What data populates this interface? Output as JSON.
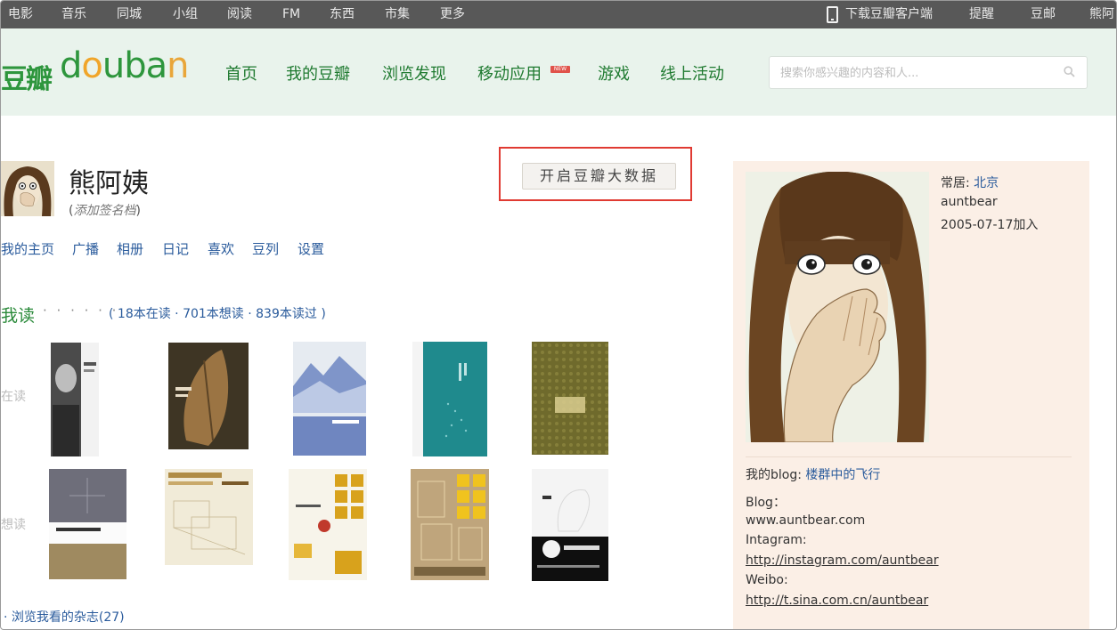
{
  "top_bar": {
    "items": [
      "电影",
      "音乐",
      "同城",
      "小组",
      "阅读",
      "FM",
      "东西",
      "市集",
      "更多"
    ],
    "download_app": "下载豆瓣客户端",
    "reminder": "提醒",
    "mail": "豆邮",
    "user": "熊阿"
  },
  "logo": {
    "cn": "豆瓣",
    "en_letters": [
      "d",
      "o",
      "u",
      "b",
      "a",
      "n"
    ]
  },
  "nav": {
    "items": [
      "首页",
      "我的豆瓣",
      "浏览发现",
      "移动应用",
      "游戏",
      "线上活动"
    ],
    "badge": "NEW"
  },
  "search": {
    "placeholder": "搜索你感兴趣的内容和人..."
  },
  "profile": {
    "name": "熊阿姨",
    "signature_open": "(",
    "signature": "添加签名档",
    "signature_close": ")",
    "big_data_button": "开启豆瓣大数据",
    "tabs": [
      "我的主页",
      "广播",
      "相册",
      "日记",
      "喜欢",
      "豆列",
      "设置"
    ]
  },
  "reading": {
    "title": "我读",
    "dots": "· · · · · ·",
    "counts": "( 18本在读 · 701本想读 · 839本读过 )",
    "reading_label": "在读",
    "want_label": "想读",
    "magazines_link": "· 浏览我看的杂志(27)"
  },
  "books": {
    "reading": [
      {
        "bg": "#f2f2f2",
        "accent": "#555555"
      },
      {
        "bg": "#3e3524",
        "accent": "#b08a55"
      },
      {
        "bg": "#dfe6ee",
        "accent": "#7b93c7"
      },
      {
        "bg": "#1f8a8d",
        "accent": "#8fd0d1"
      },
      {
        "bg": "#6f6a2c",
        "accent": "#c7b97a"
      }
    ],
    "want": [
      {
        "bg": "#6e6e7a",
        "accent": "#9f8a60"
      },
      {
        "bg": "#f1ebd8",
        "accent": "#c6a66a"
      },
      {
        "bg": "#f7f4ea",
        "accent": "#d8a21c"
      },
      {
        "bg": "#bfa57c",
        "accent": "#f0c31e"
      },
      {
        "bg": "#f4f4f4",
        "accent": "#111111"
      }
    ]
  },
  "sidebar": {
    "residence_label": "常居: ",
    "residence": "北京",
    "username": "auntbear",
    "joined": "2005-07-17加入",
    "blog_label": "我的blog: ",
    "blog_name": "楼群中的飞行",
    "blog_heading": "Blog：",
    "blog_url": "www.auntbear.com",
    "instagram_heading": "Intagram:",
    "instagram_url": "http://instagram.com/auntbear",
    "weibo_heading": "Weibo:",
    "weibo_url": "http://t.sina.com.cn/auntbear"
  },
  "colors": {
    "top_bar": "#585858",
    "header_bg": "#e9f3ec",
    "brand_green": "#2e963d",
    "link_blue": "#2a5b9c",
    "highlight_red": "#e03a32",
    "card_bg": "#fbefe6"
  }
}
